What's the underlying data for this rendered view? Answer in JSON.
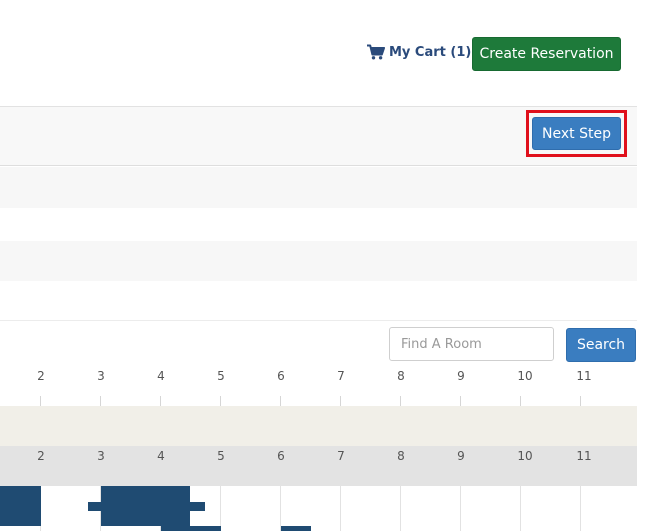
{
  "header": {
    "cart_label": "My Cart (1)",
    "create_reservation_label": "Create Reservation"
  },
  "toolbar": {
    "next_step_label": "Next Step"
  },
  "search": {
    "placeholder": "Find A Room",
    "button_label": "Search"
  },
  "timeline": {
    "hours_top": [
      "2",
      "3",
      "4",
      "5",
      "6",
      "7",
      "8",
      "9",
      "10",
      "11"
    ],
    "hours_bottom": [
      "2",
      "3",
      "4",
      "5",
      "6",
      "7",
      "8",
      "9",
      "10",
      "11"
    ]
  },
  "colors": {
    "brand_green": "#1e7a3a",
    "primary_blue": "#3a7dc0",
    "highlight_red": "#e0101c",
    "booking_navy": "#1f4b72",
    "link_navy": "#2a4a7b"
  },
  "icons": {
    "cart": "cart-icon"
  }
}
